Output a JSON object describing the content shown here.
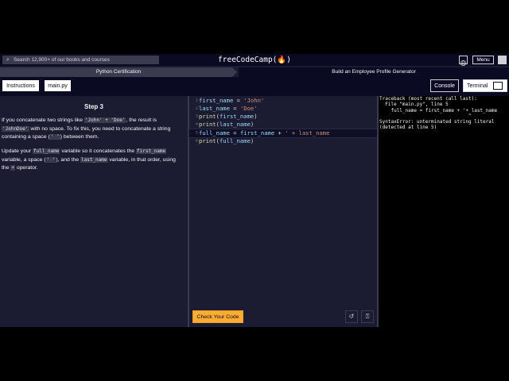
{
  "nav": {
    "search_placeholder": "Search 12,900+ of our books and courses",
    "logo": "freeCodeCamp(🔥)",
    "menu_label": "Menu"
  },
  "breadcrumb": {
    "course": "Python Certification",
    "project": "Build an Employee Profile Generator"
  },
  "toolbar": {
    "instructions": "Instructions",
    "file": "main.py",
    "console": "Console",
    "terminal": "Terminal"
  },
  "instructions": {
    "title": "Step 3",
    "p1_a": "If you concatenate two strings like ",
    "p1_code1": "'John' + 'Doe'",
    "p1_b": ", the result is ",
    "p1_code2": "'JohnDoe'",
    "p1_c": " with no space. To fix this, you need to concatenate a string containing a space (",
    "p1_code3": "' '",
    "p1_d": ") between them.",
    "p2_a": "Update your ",
    "p2_code1": "full_name",
    "p2_b": " variable so it concatenates the ",
    "p2_code2": "first_name",
    "p2_c": " variable, a space (",
    "p2_code3": "' '",
    "p2_d": "), and the ",
    "p2_code4": "last_name",
    "p2_e": " variable, in that order, using the ",
    "p2_code5": "+",
    "p2_f": " operator."
  },
  "editor": {
    "lines": [
      {
        "n": "1",
        "text": "first_name = 'John'"
      },
      {
        "n": "2",
        "text": "last_name = 'Doe'"
      },
      {
        "n": "3",
        "text": "print(first_name)"
      },
      {
        "n": "4",
        "text": "print(last_name)"
      },
      {
        "n": "5",
        "text": "full_name = first_name + ' + last_name"
      },
      {
        "n": "6",
        "text": "print(full_name)"
      }
    ],
    "check_button": "Check Your Code"
  },
  "console": {
    "output": "Traceback (most recent call last):\n  File \"main.py\", line 5\n    full_name = first_name + '+ last_name\n                               ^\nSyntaxError: unterminated string literal (detected at line 5)"
  },
  "colors": {
    "accent": "#feac32",
    "background": "#1b1b32",
    "nav": "#0a0a23"
  }
}
